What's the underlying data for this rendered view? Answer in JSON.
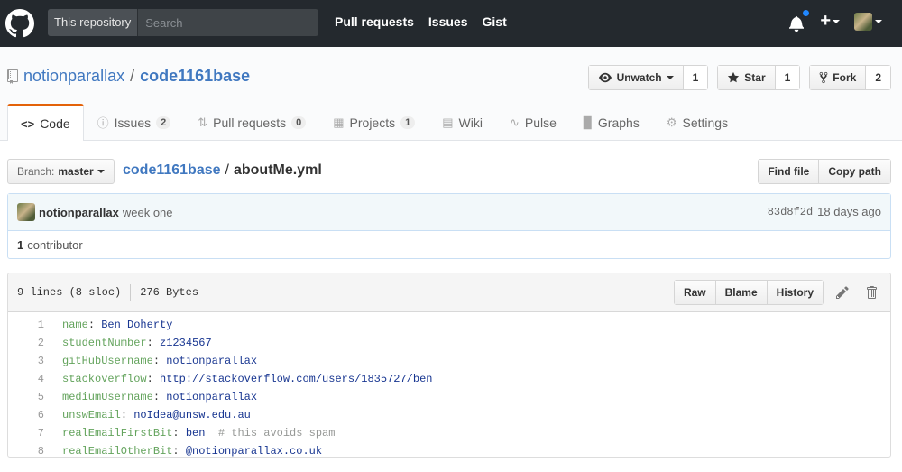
{
  "header": {
    "scope_label": "This repository",
    "search_placeholder": "Search",
    "nav": [
      "Pull requests",
      "Issues",
      "Gist"
    ]
  },
  "repo": {
    "owner": "notionparallax",
    "name": "code1161base",
    "watch": {
      "label": "Unwatch",
      "count": "1"
    },
    "star": {
      "label": "Star",
      "count": "1"
    },
    "fork": {
      "label": "Fork",
      "count": "2"
    }
  },
  "tabs": [
    {
      "label": "Code",
      "icon": "code-icon"
    },
    {
      "label": "Issues",
      "count": "2",
      "icon": "issue-icon"
    },
    {
      "label": "Pull requests",
      "count": "0",
      "icon": "pull-request-icon"
    },
    {
      "label": "Projects",
      "count": "1",
      "icon": "project-icon"
    },
    {
      "label": "Wiki",
      "icon": "book-icon"
    },
    {
      "label": "Pulse",
      "icon": "pulse-icon"
    },
    {
      "label": "Graphs",
      "icon": "graph-icon"
    },
    {
      "label": "Settings",
      "icon": "gear-icon"
    }
  ],
  "filenav": {
    "branch_prefix": "Branch:",
    "branch": "master",
    "repo_link": "code1161base",
    "separator": "/",
    "file": "aboutMe.yml",
    "find_file": "Find file",
    "copy_path": "Copy path"
  },
  "commit": {
    "author": "notionparallax",
    "message": "week one",
    "sha": "83d8f2d",
    "when": "18 days ago",
    "contributors_count": "1",
    "contributors_label": "contributor"
  },
  "file": {
    "lines_info": "9 lines (8 sloc)",
    "size": "276 Bytes",
    "raw": "Raw",
    "blame": "Blame",
    "history": "History",
    "lines": [
      {
        "n": "1",
        "key": "name",
        "value": "Ben Doherty",
        "comment": ""
      },
      {
        "n": "2",
        "key": "studentNumber",
        "value": "z1234567",
        "comment": ""
      },
      {
        "n": "3",
        "key": "gitHubUsername",
        "value": "notionparallax",
        "comment": ""
      },
      {
        "n": "4",
        "key": "stackoverflow",
        "value": "http://stackoverflow.com/users/1835727/ben",
        "comment": ""
      },
      {
        "n": "5",
        "key": "mediumUsername",
        "value": "notionparallax",
        "comment": ""
      },
      {
        "n": "6",
        "key": "unswEmail",
        "value": "noIdea@unsw.edu.au",
        "comment": ""
      },
      {
        "n": "7",
        "key": "realEmailFirstBit",
        "value": "ben",
        "comment": "# this avoids spam"
      },
      {
        "n": "8",
        "key": "realEmailOtherBit",
        "value": "@notionparallax.co.uk",
        "comment": ""
      }
    ]
  },
  "colors": {
    "header_bg": "#24292e",
    "link": "#4078c0",
    "tab_accent": "#e36209",
    "notification": "#2188ff"
  }
}
